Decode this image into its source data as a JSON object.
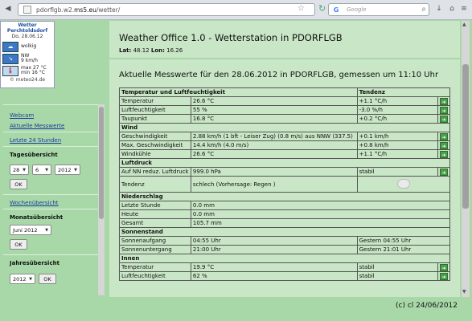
{
  "browser": {
    "url_prefix": "pdorflgb.w2.",
    "url_domain": "ms5.eu",
    "url_suffix": "/wetter/",
    "search_placeholder": "Google"
  },
  "widget": {
    "title_line1": "Wetter",
    "title_line2": "Perchtoldsdorf",
    "date": "Do, 28.06.12",
    "condition": "wolkig",
    "wind_dir": "NW",
    "wind_speed": "9 km/h",
    "temp_max": "max  27 °C",
    "temp_min": "min  16 °C",
    "footer": "© meteo24.de"
  },
  "sidebar": {
    "webcam": "Webcam",
    "current": "Aktuelle Messwerte",
    "last24": "Letzte 24 Stunden",
    "daily_heading": "Tagesübersicht",
    "day_value": "28",
    "month_value": "6",
    "year_value": "2012",
    "ok1": "OK",
    "weekly": "Wochenübersicht",
    "monthly_heading": "Monatsübersicht",
    "month_select": "Juni 2012",
    "ok2": "OK",
    "yearly_heading": "Jahresübersicht",
    "year_select": "2012",
    "ok3": "OK"
  },
  "header": {
    "title": "Weather Office 1.0 - Wetterstation in PDORFLGB",
    "lat_label": "Lat:",
    "lat": "48.12",
    "lon_label": "Lon:",
    "lon": "16.26"
  },
  "content": {
    "title": "Aktuelle Messwerte für den 28.06.2012 in PDORFLGB, gemessen um 11:10 Uhr"
  },
  "table": {
    "h_temp_humidity": "Temperatur und Luftfeuchtigkeit",
    "h_tendency": "Tendenz",
    "temperature_label": "Temperatur",
    "temperature_value": "26.6 °C",
    "temperature_trend": "+1.1 °C/h",
    "humidity_label": "Luftfeuchtigkeit",
    "humidity_value": "55 %",
    "humidity_trend": "-3.0 %/h",
    "dewpoint_label": "Taupunkt",
    "dewpoint_value": "16.8 °C",
    "dewpoint_trend": "+0.2 °C/h",
    "h_wind": "Wind",
    "windspeed_label": "Geschwindigkeit",
    "windspeed_value": "2.88 km/h (1 bft - Leiser Zug) (0.8 m/s) aus NNW (337.5)",
    "windspeed_trend": "+0.1 km/h",
    "windmax_label": "Max. Geschwindigkeit",
    "windmax_value": "14.4 km/h (4.0 m/s)",
    "windmax_trend": "+0.8 km/h",
    "windchill_label": "Windkühle",
    "windchill_value": "26.6 °C",
    "windchill_trend": "+1.1 °C/h",
    "h_pressure": "Luftdruck",
    "pressure_label": "Auf NN reduz. Luftdruck",
    "pressure_value": "999.0 hPa",
    "pressure_trend": "stabil",
    "tendency_label": "Tendenz",
    "tendency_value": "schlech (Vorhersage: Regen )",
    "h_precip": "Niederschlag",
    "lasthour_label": "Letzte Stunde",
    "lasthour_value": "0.0 mm",
    "today_label": "Heute",
    "today_value": "0.0 mm",
    "total_label": "Gesamt",
    "total_value": "105.7 mm",
    "h_sun": "Sonnenstand",
    "sunrise_label": "Sonnenaufgang",
    "sunrise_value": "04:55 Uhr",
    "sunrise_yesterday": "Gestern 04:55 Uhr",
    "sunset_label": "Sonnenuntergang",
    "sunset_value": "21:00 Uhr",
    "sunset_yesterday": "Gestern 21:01 Uhr",
    "h_indoor": "Innen",
    "in_temp_label": "Temperatur",
    "in_temp_value": "19.9 °C",
    "in_temp_trend": "stabil",
    "in_hum_label": "Luftfeuchtigkeit",
    "in_hum_value": "62 %",
    "in_hum_trend": "stabil"
  },
  "footer": {
    "copyright": "(c) cl 24/06/2012"
  },
  "colors": {
    "page_green": "#a8d8a8",
    "panel_green": "#c9e7c6",
    "link_blue": "#1a3d9e"
  }
}
